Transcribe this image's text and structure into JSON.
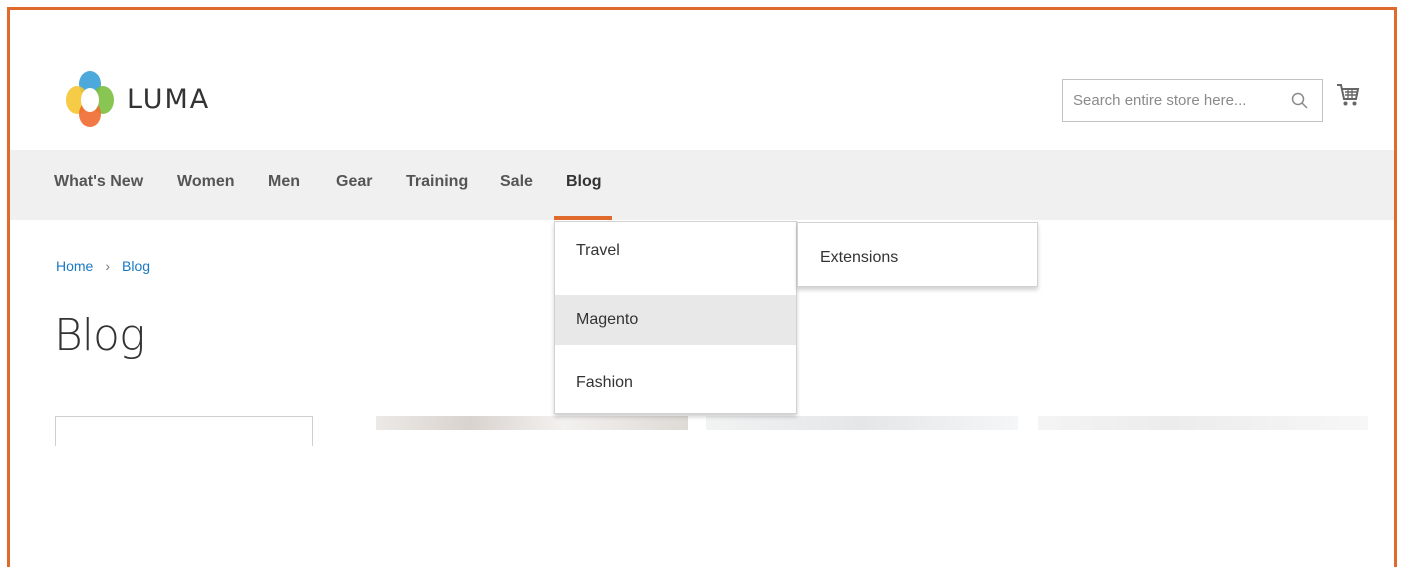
{
  "brand": {
    "name": "LUMA"
  },
  "search": {
    "placeholder": "Search entire store here..."
  },
  "nav": {
    "items": [
      "What's New",
      "Women",
      "Men",
      "Gear",
      "Training",
      "Sale",
      "Blog"
    ],
    "active": "Blog"
  },
  "breadcrumb": {
    "home": "Home",
    "separator": "›",
    "current": "Blog"
  },
  "page": {
    "title": "Blog"
  },
  "blog_menu": {
    "items": [
      "Travel",
      "Magento",
      "Fashion"
    ],
    "hovered": "Magento",
    "submenu": [
      "Extensions"
    ]
  },
  "colors": {
    "accent": "#e06a2b",
    "link": "#1979c3",
    "nav_bg": "#f0f0f0"
  },
  "icons": [
    "logo-icon",
    "search-icon",
    "cart-icon"
  ]
}
